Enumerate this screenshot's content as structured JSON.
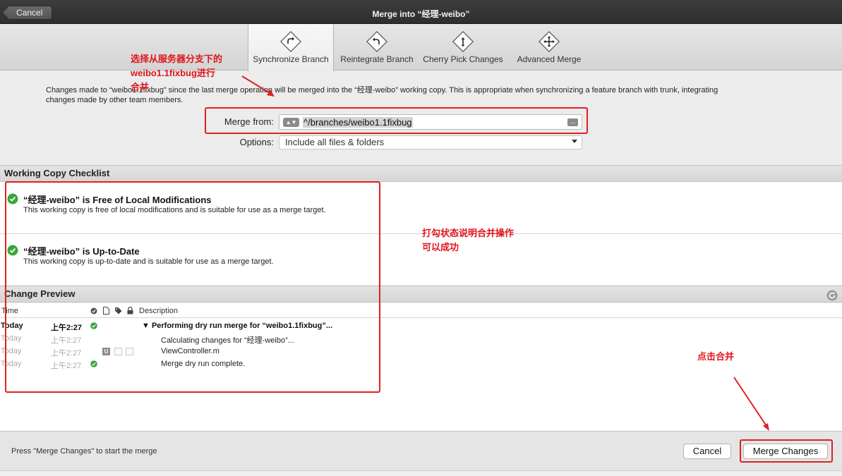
{
  "window": {
    "back_label": "Cancel",
    "title": "Merge into “经理-weibo”"
  },
  "toolbar": {
    "tabs": [
      {
        "label": "Synchronize Branch",
        "icon": "synchronize-branch-icon",
        "active": true
      },
      {
        "label": "Reintegrate Branch",
        "icon": "reintegrate-branch-icon",
        "active": false
      },
      {
        "label": "Cherry Pick Changes",
        "icon": "cherry-pick-icon",
        "active": false
      },
      {
        "label": "Advanced Merge",
        "icon": "advanced-merge-icon",
        "active": false
      }
    ]
  },
  "description": {
    "line1": "Changes made to “weibo1.1fixbug” since the last merge operation will be merged into the “经理-weibo” working copy. This is appropriate when synchronizing a feature branch with trunk, integrating",
    "line2": "changes made by other team members."
  },
  "form": {
    "merge_from_label": "Merge from:",
    "merge_from_value": "^/branches/weibo1.1fixbug",
    "options_label": "Options:",
    "options_value": "Include all files & folders"
  },
  "checklist": {
    "header": "Working Copy Checklist",
    "items": [
      {
        "title": "“经理-weibo” is Free of Local Modifications",
        "subtitle": "This working copy is free of local modifications and is suitable for use as a merge target."
      },
      {
        "title": "“经理-weibo” is Up-to-Date",
        "subtitle": "This working copy is up-to-date and is suitable for use as a merge target."
      }
    ]
  },
  "preview": {
    "header": "Change Preview",
    "columns": {
      "time": "Time",
      "description": "Description"
    },
    "rows": [
      {
        "day": "Today",
        "time": "上午2:27",
        "description": "▼ Performing dry run merge for “weibo1.1fixbug”..."
      },
      {
        "day": "Today",
        "time": "上午2:27",
        "description": "Calculating changes for “经理-weibo”..."
      },
      {
        "day": "Today",
        "time": "上午2:27",
        "description": "ViewController.m",
        "status_letter": "U"
      },
      {
        "day": "Today",
        "time": "上午2:27",
        "description": "Merge dry run complete."
      }
    ]
  },
  "footer": {
    "status": "Press \"Merge Changes\" to start the merge",
    "cancel_label": "Cancel",
    "merge_label": "Merge Changes"
  },
  "annotations": {
    "top_note_line1": "选择从服务器分支下的",
    "top_note_line2": "weibo1.1fixbug进行",
    "top_note_line3": "合并",
    "middle_note_line1": "打勾状态说明合并操作",
    "middle_note_line2": "可以成功",
    "right_note": "点击合并"
  },
  "colors": {
    "annotation_red": "#e02020",
    "check_green": "#3aa63a",
    "title_bar": "#333333"
  }
}
